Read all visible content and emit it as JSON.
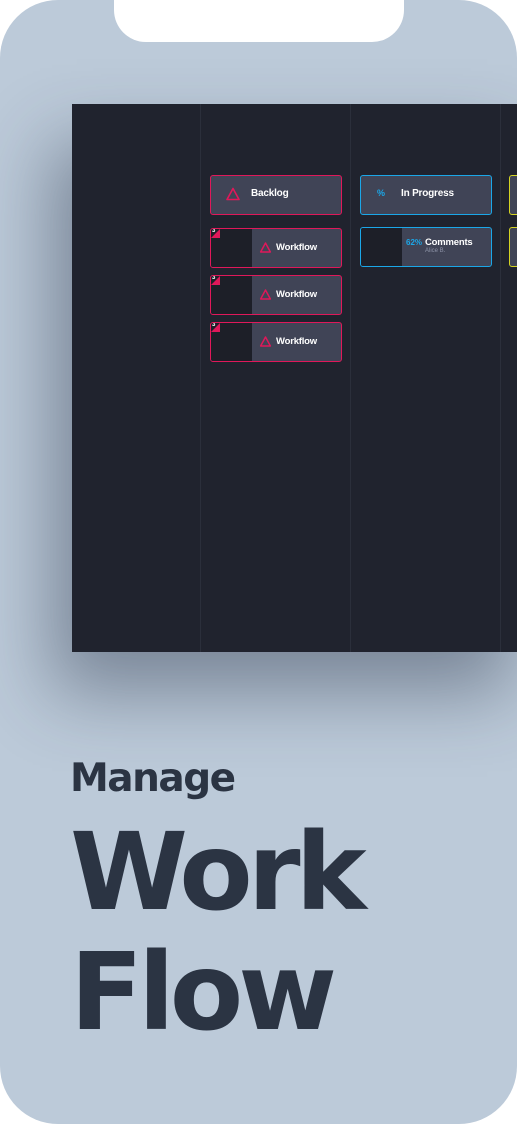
{
  "colors": {
    "background": "#bccad9",
    "board": "#20232e",
    "card": "#404456",
    "backlog_accent": "#e0185a",
    "progress_accent": "#1ba7e8",
    "review_accent": "#d4d423",
    "headline": "#2b3443"
  },
  "board": {
    "columns": [
      {
        "label": "Backlog",
        "icon": "triangle-icon",
        "cards": [
          {
            "count": "3",
            "label": "Workflow",
            "icon": "triangle-icon"
          },
          {
            "count": "3",
            "label": "Workflow",
            "icon": "triangle-icon"
          },
          {
            "count": "3",
            "label": "Workflow",
            "icon": "triangle-icon"
          }
        ]
      },
      {
        "label": "In Progress",
        "icon": "%",
        "cards": [
          {
            "progress": "62%",
            "label": "Comments",
            "sub": "Alice B."
          }
        ]
      }
    ]
  },
  "headline": {
    "line1": "Manage",
    "line2": "Work",
    "line3": "Flow"
  }
}
